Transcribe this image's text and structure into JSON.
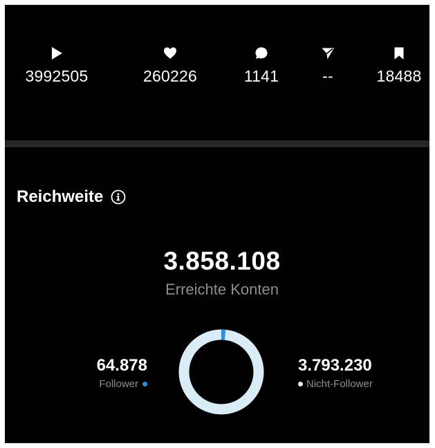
{
  "metrics": [
    {
      "icon": "play-icon",
      "value": "3992505"
    },
    {
      "icon": "heart-icon",
      "value": "260226"
    },
    {
      "icon": "comment-icon",
      "value": "1141"
    },
    {
      "icon": "send-icon",
      "value": "--"
    },
    {
      "icon": "bookmark-icon",
      "value": "18488"
    }
  ],
  "reach": {
    "title": "Reichweite",
    "info_icon": "info-icon",
    "total": "3.858.108",
    "total_label": "Erreichte Konten",
    "follower_value": "64.878",
    "follower_label": "Follower",
    "nonfollower_value": "3.793.230",
    "nonfollower_label": "Nicht-Follower",
    "follower_share": 0.0168,
    "nonfollower_share": 0.9832
  },
  "colors": {
    "background": "#000000",
    "divider": "#262626",
    "follower": "#2f8fd8",
    "nonfollower": "#d9ecf7",
    "muted_text": "#8e8e8e"
  }
}
